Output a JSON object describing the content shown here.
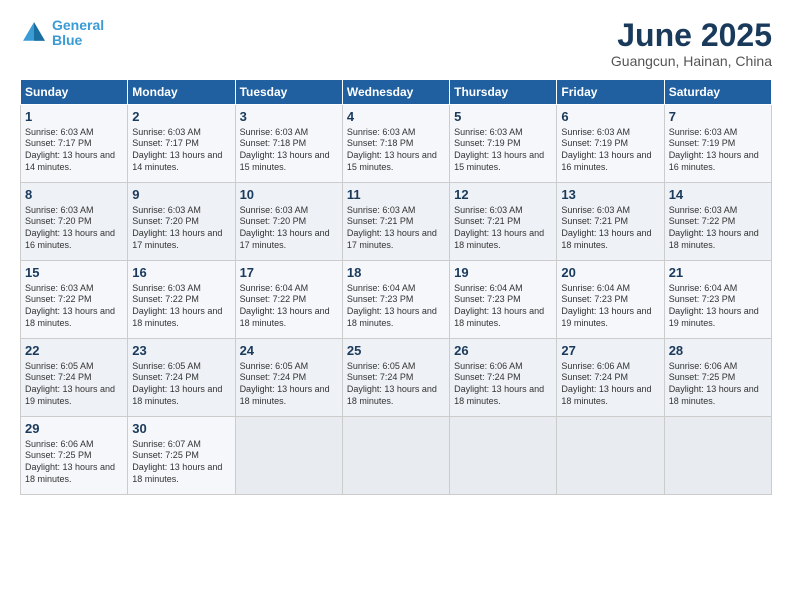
{
  "logo": {
    "line1": "General",
    "line2": "Blue"
  },
  "title": "June 2025",
  "location": "Guangcun, Hainan, China",
  "days_of_week": [
    "Sunday",
    "Monday",
    "Tuesday",
    "Wednesday",
    "Thursday",
    "Friday",
    "Saturday"
  ],
  "weeks": [
    [
      {
        "day": 1,
        "sunrise": "6:03 AM",
        "sunset": "7:17 PM",
        "daylight": "13 hours and 14 minutes."
      },
      {
        "day": 2,
        "sunrise": "6:03 AM",
        "sunset": "7:17 PM",
        "daylight": "13 hours and 14 minutes."
      },
      {
        "day": 3,
        "sunrise": "6:03 AM",
        "sunset": "7:18 PM",
        "daylight": "13 hours and 15 minutes."
      },
      {
        "day": 4,
        "sunrise": "6:03 AM",
        "sunset": "7:18 PM",
        "daylight": "13 hours and 15 minutes."
      },
      {
        "day": 5,
        "sunrise": "6:03 AM",
        "sunset": "7:19 PM",
        "daylight": "13 hours and 15 minutes."
      },
      {
        "day": 6,
        "sunrise": "6:03 AM",
        "sunset": "7:19 PM",
        "daylight": "13 hours and 16 minutes."
      },
      {
        "day": 7,
        "sunrise": "6:03 AM",
        "sunset": "7:19 PM",
        "daylight": "13 hours and 16 minutes."
      }
    ],
    [
      {
        "day": 8,
        "sunrise": "6:03 AM",
        "sunset": "7:20 PM",
        "daylight": "13 hours and 16 minutes."
      },
      {
        "day": 9,
        "sunrise": "6:03 AM",
        "sunset": "7:20 PM",
        "daylight": "13 hours and 17 minutes."
      },
      {
        "day": 10,
        "sunrise": "6:03 AM",
        "sunset": "7:20 PM",
        "daylight": "13 hours and 17 minutes."
      },
      {
        "day": 11,
        "sunrise": "6:03 AM",
        "sunset": "7:21 PM",
        "daylight": "13 hours and 17 minutes."
      },
      {
        "day": 12,
        "sunrise": "6:03 AM",
        "sunset": "7:21 PM",
        "daylight": "13 hours and 18 minutes."
      },
      {
        "day": 13,
        "sunrise": "6:03 AM",
        "sunset": "7:21 PM",
        "daylight": "13 hours and 18 minutes."
      },
      {
        "day": 14,
        "sunrise": "6:03 AM",
        "sunset": "7:22 PM",
        "daylight": "13 hours and 18 minutes."
      }
    ],
    [
      {
        "day": 15,
        "sunrise": "6:03 AM",
        "sunset": "7:22 PM",
        "daylight": "13 hours and 18 minutes."
      },
      {
        "day": 16,
        "sunrise": "6:03 AM",
        "sunset": "7:22 PM",
        "daylight": "13 hours and 18 minutes."
      },
      {
        "day": 17,
        "sunrise": "6:04 AM",
        "sunset": "7:22 PM",
        "daylight": "13 hours and 18 minutes."
      },
      {
        "day": 18,
        "sunrise": "6:04 AM",
        "sunset": "7:23 PM",
        "daylight": "13 hours and 18 minutes."
      },
      {
        "day": 19,
        "sunrise": "6:04 AM",
        "sunset": "7:23 PM",
        "daylight": "13 hours and 18 minutes."
      },
      {
        "day": 20,
        "sunrise": "6:04 AM",
        "sunset": "7:23 PM",
        "daylight": "13 hours and 19 minutes."
      },
      {
        "day": 21,
        "sunrise": "6:04 AM",
        "sunset": "7:23 PM",
        "daylight": "13 hours and 19 minutes."
      }
    ],
    [
      {
        "day": 22,
        "sunrise": "6:05 AM",
        "sunset": "7:24 PM",
        "daylight": "13 hours and 19 minutes."
      },
      {
        "day": 23,
        "sunrise": "6:05 AM",
        "sunset": "7:24 PM",
        "daylight": "13 hours and 18 minutes."
      },
      {
        "day": 24,
        "sunrise": "6:05 AM",
        "sunset": "7:24 PM",
        "daylight": "13 hours and 18 minutes."
      },
      {
        "day": 25,
        "sunrise": "6:05 AM",
        "sunset": "7:24 PM",
        "daylight": "13 hours and 18 minutes."
      },
      {
        "day": 26,
        "sunrise": "6:06 AM",
        "sunset": "7:24 PM",
        "daylight": "13 hours and 18 minutes."
      },
      {
        "day": 27,
        "sunrise": "6:06 AM",
        "sunset": "7:24 PM",
        "daylight": "13 hours and 18 minutes."
      },
      {
        "day": 28,
        "sunrise": "6:06 AM",
        "sunset": "7:25 PM",
        "daylight": "13 hours and 18 minutes."
      }
    ],
    [
      {
        "day": 29,
        "sunrise": "6:06 AM",
        "sunset": "7:25 PM",
        "daylight": "13 hours and 18 minutes."
      },
      {
        "day": 30,
        "sunrise": "6:07 AM",
        "sunset": "7:25 PM",
        "daylight": "13 hours and 18 minutes."
      },
      null,
      null,
      null,
      null,
      null
    ]
  ]
}
